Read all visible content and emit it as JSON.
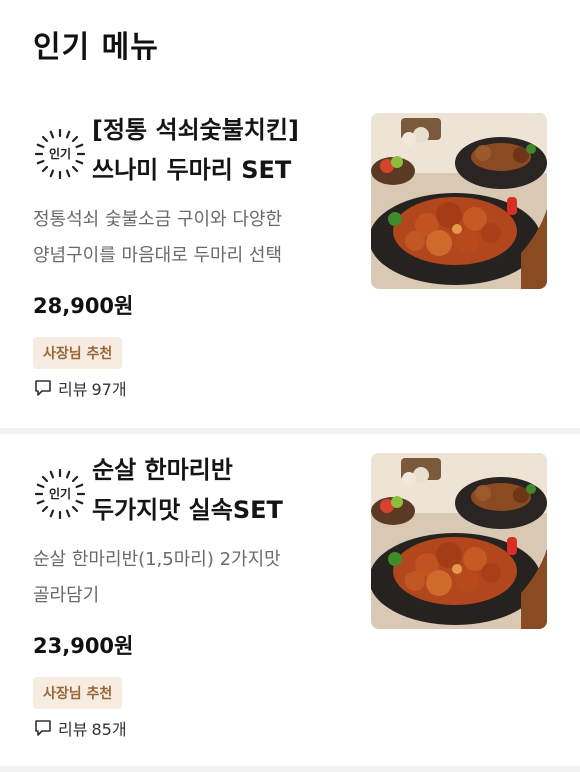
{
  "section": {
    "title": "인기 메뉴"
  },
  "menu": [
    {
      "badge": "인기",
      "name_line1": "[정통 석쇠숯불치킨]",
      "name_line2": "쓰나미 두마리 SET",
      "desc_line1": "정통석쇠 숯불소금 구이와 다양한",
      "desc_line2": "양념구이를 마음대로 두마리 선택",
      "price": "28,900원",
      "tag": "사장님 추천",
      "review_label": "리뷰",
      "review_count": "97개",
      "image_icon": "grilled-chicken-photo"
    },
    {
      "badge": "인기",
      "name_line1": "순살 한마리반",
      "name_line2": "두가지맛 실속SET",
      "desc_line1": "순살 한마리반(1,5마리) 2가지맛",
      "desc_line2": "골라담기",
      "price": "23,900원",
      "tag": "사장님 추천",
      "review_label": "리뷰",
      "review_count": "85개",
      "image_icon": "grilled-chicken-photo"
    }
  ],
  "colors": {
    "tag_bg": "#f6ece2",
    "tag_text": "#9a6636",
    "desc_text": "#6a6a6a",
    "divider": "#f2f2f2"
  }
}
